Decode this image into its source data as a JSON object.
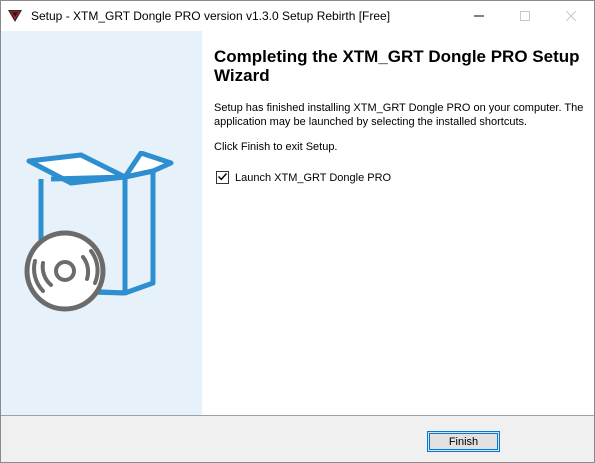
{
  "window": {
    "title": "Setup - XTM_GRT Dongle PRO version v1.3.0 Setup Rebirth [Free]",
    "app_icon": "shield-logo-icon",
    "controls": {
      "minimize": "minimize-icon",
      "maximize": "maximize-icon",
      "close": "close-icon"
    }
  },
  "sidebar": {
    "illustration": "software-box-with-disc-icon",
    "colors": {
      "background": "#e6f1f9",
      "box_stroke": "#2d8fcf",
      "disc_stroke": "#6b6b6b"
    }
  },
  "content": {
    "heading": "Completing the XTM_GRT Dongle PRO Setup Wizard",
    "description": "Setup has finished installing XTM_GRT Dongle PRO on your computer. The application may be launched by selecting the installed shortcuts.",
    "instruction": "Click Finish to exit Setup.",
    "launch_checkbox": {
      "label": "Launch XTM_GRT Dongle PRO",
      "checked": true
    }
  },
  "footer": {
    "finish_label": "Finish"
  },
  "colors": {
    "accent": "#0078d7",
    "footer_bg": "#f0f0f0"
  }
}
